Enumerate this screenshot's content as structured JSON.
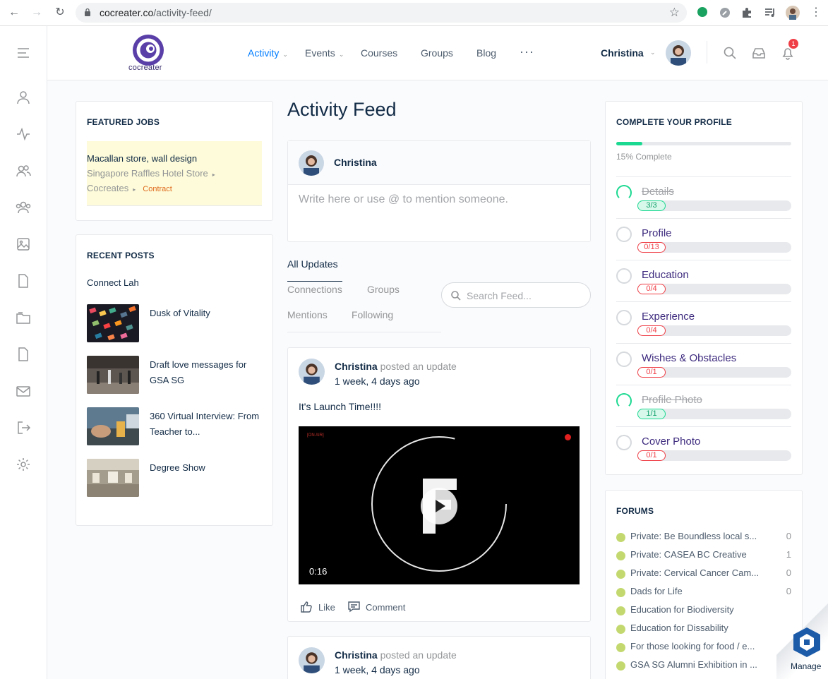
{
  "browser": {
    "url_host": "cocreater.co",
    "url_path": "/activity-feed/"
  },
  "header": {
    "logo_text": "cocreater",
    "nav": [
      {
        "label": "Activity",
        "active": true,
        "dropdown": true
      },
      {
        "label": "Events",
        "active": false,
        "dropdown": true
      },
      {
        "label": "Courses",
        "active": false,
        "dropdown": false
      },
      {
        "label": "Groups",
        "active": false,
        "dropdown": false
      },
      {
        "label": "Blog",
        "active": false,
        "dropdown": false
      }
    ],
    "more": "···",
    "user_name": "Christina",
    "notification_count": "1"
  },
  "featured_jobs": {
    "title": "FEATURED JOBS",
    "job": {
      "title": "Macallan store, wall design",
      "company": "Singapore Raffles Hotel Store",
      "poster": "Cocreates",
      "type": "Contract"
    }
  },
  "recent_posts": {
    "title": "RECENT POSTS",
    "first": "Connect Lah",
    "items": [
      {
        "title": "Dusk of Vitality"
      },
      {
        "title": "Draft love messages for GSA SG"
      },
      {
        "title": "360 Virtual Interview: From Teacher to..."
      },
      {
        "title": "Degree Show"
      }
    ]
  },
  "main": {
    "page_title": "Activity Feed",
    "composer": {
      "user_name": "Christina",
      "placeholder": "Write here or use @ to mention someone."
    },
    "tabs": {
      "all": "All Updates",
      "connections": "Connections",
      "groups": "Groups",
      "mentions": "Mentions",
      "following": "Following"
    },
    "search_placeholder": "Search Feed...",
    "posts": [
      {
        "author": "Christina",
        "action": "posted an update",
        "time": "1 week, 4 days ago",
        "body": "It's Launch Time!!!!",
        "video_duration": "0:16",
        "video_overlay": "[ON AIR]",
        "like": "Like",
        "comment": "Comment"
      },
      {
        "author": "Christina",
        "action": "posted an update",
        "time": "1 week, 4 days ago"
      }
    ]
  },
  "profile_completion": {
    "title": "COMPLETE YOUR PROFILE",
    "percent": 15,
    "percent_label": "15% Complete",
    "steps": [
      {
        "label": "Details",
        "count": "3/3",
        "done": true
      },
      {
        "label": "Profile",
        "count": "0/13",
        "done": false
      },
      {
        "label": "Education",
        "count": "0/4",
        "done": false
      },
      {
        "label": "Experience",
        "count": "0/4",
        "done": false
      },
      {
        "label": "Wishes & Obstacles",
        "count": "0/1",
        "done": false
      },
      {
        "label": "Profile Photo",
        "count": "1/1",
        "done": true
      },
      {
        "label": "Cover Photo",
        "count": "0/1",
        "done": false
      }
    ]
  },
  "forums": {
    "title": "FORUMS",
    "items": [
      {
        "name": "Private: Be Boundless local s...",
        "count": "0"
      },
      {
        "name": "Private: CASEA BC Creative",
        "count": "1"
      },
      {
        "name": "Private: Cervical Cancer Cam...",
        "count": "0"
      },
      {
        "name": "Dads for Life",
        "count": "0"
      },
      {
        "name": "Education for Biodiversity",
        "count": ""
      },
      {
        "name": "Education for Dissability",
        "count": ""
      },
      {
        "name": "For those looking for food / e...",
        "count": ""
      },
      {
        "name": "GSA SG Alumni Exhibition in ...",
        "count": ""
      }
    ]
  },
  "manage_label": "Manage",
  "colors": {
    "accent": "#007cff",
    "progress": "#1cd991",
    "danger": "#ef3e46",
    "forum_dot": "#c3d96f"
  }
}
